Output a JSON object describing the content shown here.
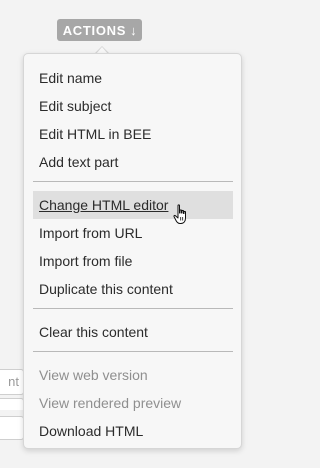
{
  "actions_button": {
    "label": "ACTIONS",
    "arrow": "↓"
  },
  "background_inputs": {
    "first_value_fragment": "nt"
  },
  "menu": {
    "groups": [
      {
        "items": [
          {
            "label": "Edit name",
            "disabled": false
          },
          {
            "label": "Edit subject",
            "disabled": false
          },
          {
            "label": "Edit HTML in BEE",
            "disabled": false
          },
          {
            "label": "Add text part",
            "disabled": false
          }
        ]
      },
      {
        "items": [
          {
            "label": "Change HTML editor",
            "disabled": false,
            "hovered": true
          },
          {
            "label": "Import from URL",
            "disabled": false
          },
          {
            "label": "Import from file",
            "disabled": false
          },
          {
            "label": "Duplicate this content",
            "disabled": false
          }
        ]
      },
      {
        "items": [
          {
            "label": "Clear this content",
            "disabled": false
          }
        ]
      },
      {
        "items": [
          {
            "label": "View web version",
            "disabled": true
          },
          {
            "label": "View rendered preview",
            "disabled": true
          },
          {
            "label": "Download HTML",
            "disabled": false
          }
        ]
      }
    ]
  },
  "cursor": {
    "icon": "hand-pointer-icon"
  },
  "colors": {
    "button_bg": "#a7a7a7",
    "menu_bg": "#f7f7f7",
    "hover_bg": "#dfdfdf",
    "text": "#2b2b2b",
    "disabled_text": "#8f8f8f"
  }
}
